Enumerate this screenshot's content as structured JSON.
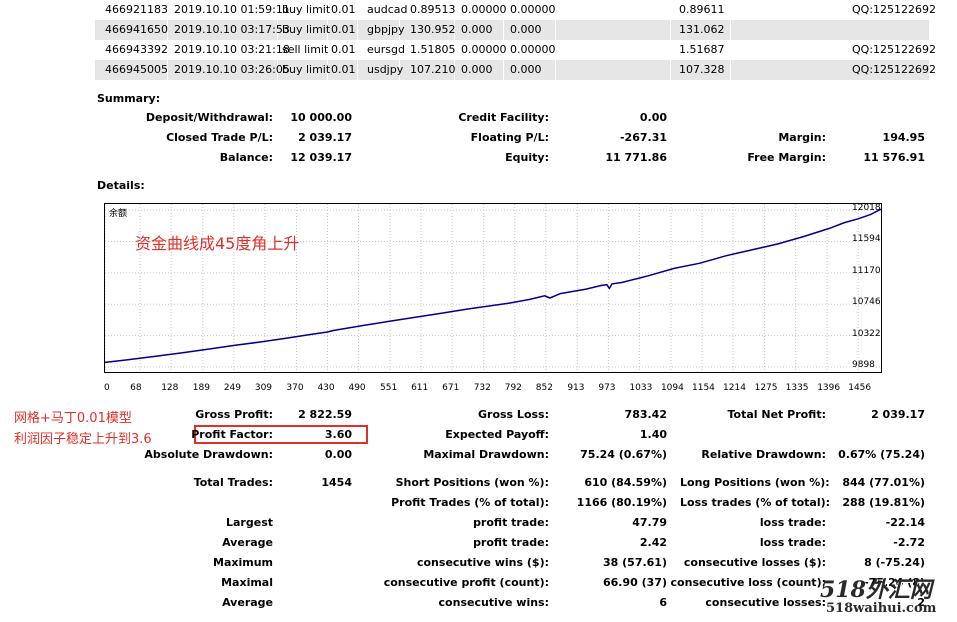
{
  "orders": [
    {
      "ticket": "466921183",
      "time": "2019.10.10 01:59:11",
      "type": "buy limit",
      "size": "0.01",
      "item": "audcad",
      "price": "0.89513",
      "sl": "0.00000",
      "tp": "0.00000",
      "cur_price": "0.89611",
      "comment": "QQ:125122692",
      "shaded": false
    },
    {
      "ticket": "466941650",
      "time": "2019.10.10 03:17:53",
      "type": "buy limit",
      "size": "0.01",
      "item": "gbpjpy",
      "price": "130.952",
      "sl": "0.000",
      "tp": "0.000",
      "cur_price": "131.062",
      "comment": "",
      "shaded": true
    },
    {
      "ticket": "466943392",
      "time": "2019.10.10 03:21:18",
      "type": "sell limit",
      "size": "0.01",
      "item": "eursgd",
      "price": "1.51805",
      "sl": "0.00000",
      "tp": "0.00000",
      "cur_price": "1.51687",
      "comment": "QQ:125122692",
      "shaded": false
    },
    {
      "ticket": "466945005",
      "time": "2019.10.10 03:26:05",
      "type": "buy limit",
      "size": "0.01",
      "item": "usdjpy",
      "price": "107.210",
      "sl": "0.000",
      "tp": "0.000",
      "cur_price": "107.328",
      "comment": "QQ:125122692",
      "shaded": true
    }
  ],
  "summary": {
    "heading": "Summary:",
    "deposit_label": "Deposit/Withdrawal:",
    "deposit_value": "10 000.00",
    "credit_label": "Credit Facility:",
    "credit_value": "0.00",
    "closed_label": "Closed Trade P/L:",
    "closed_value": "2 039.17",
    "floating_label": "Floating P/L:",
    "floating_value": "-267.31",
    "margin_label": "Margin:",
    "margin_value": "194.95",
    "balance_label": "Balance:",
    "balance_value": "12 039.17",
    "equity_label": "Equity:",
    "equity_value": "11 771.86",
    "free_margin_label": "Free Margin:",
    "free_margin_value": "11 576.91"
  },
  "details": {
    "heading": "Details:"
  },
  "annotations": {
    "chart_note": "资金曲线成45度角上升",
    "pf_note_line1": "网格+马丁0.01模型",
    "pf_note_line2": "利润因子稳定上升到3.6",
    "watermark_top": "518外汇网",
    "watermark_bottom": "518waihui.com",
    "red_color": "#e0302a"
  },
  "chart_data": {
    "type": "line",
    "title": "余额",
    "x_ticks": [
      0,
      68,
      128,
      189,
      249,
      309,
      370,
      430,
      490,
      551,
      611,
      671,
      732,
      792,
      852,
      913,
      973,
      1033,
      1094,
      1154,
      1214,
      1275,
      1335,
      1396,
      1456
    ],
    "y_ticks": [
      9898,
      10322,
      10746,
      11170,
      11594,
      12018
    ],
    "xlim": [
      0,
      1500
    ],
    "ylim": [
      9830,
      12100
    ],
    "grid": true,
    "line_color": "#00008b",
    "series": [
      {
        "x": [
          0,
          50,
          100,
          150,
          200,
          250,
          300,
          350,
          400,
          430,
          440,
          500,
          550,
          600,
          650,
          700,
          720,
          780,
          820,
          850,
          860,
          880,
          930,
          960,
          970,
          975,
          980,
          1000,
          1050,
          1100,
          1150,
          1200,
          1250,
          1300,
          1350,
          1400,
          1430,
          1456,
          1480,
          1500
        ],
        "y": [
          9960,
          10000,
          10045,
          10090,
          10140,
          10190,
          10235,
          10285,
          10340,
          10370,
          10390,
          10460,
          10515,
          10570,
          10625,
          10680,
          10700,
          10760,
          10810,
          10860,
          10830,
          10890,
          10950,
          11000,
          11010,
          10960,
          11020,
          11040,
          11130,
          11230,
          11300,
          11400,
          11480,
          11560,
          11660,
          11770,
          11850,
          11900,
          11960,
          12030
        ]
      }
    ]
  },
  "stats": {
    "gross_profit_label": "Gross Profit:",
    "gross_profit_value": "2 822.59",
    "gross_loss_label": "Gross Loss:",
    "gross_loss_value": "783.42",
    "net_profit_label": "Total Net Profit:",
    "net_profit_value": "2 039.17",
    "profit_factor_label": "Profit Factor:",
    "profit_factor_value": "3.60",
    "expected_payoff_label": "Expected Payoff:",
    "expected_payoff_value": "1.40",
    "abs_drawdown_label": "Absolute Drawdown:",
    "abs_drawdown_value": "0.00",
    "max_drawdown_label": "Maximal Drawdown:",
    "max_drawdown_value": "75.24 (0.67%)",
    "rel_drawdown_label": "Relative Drawdown:",
    "rel_drawdown_value": "0.67% (75.24)",
    "total_trades_label": "Total Trades:",
    "total_trades_value": "1454",
    "short_label": "Short Positions (won %):",
    "short_value": "610 (84.59%)",
    "long_label": "Long Positions (won %):",
    "long_value": "844 (77.01%)",
    "profit_trades_label": "Profit Trades (% of total):",
    "profit_trades_value": "1166 (80.19%)",
    "loss_trades_label": "Loss trades (% of total):",
    "loss_trades_value": "288 (19.81%)",
    "largest_label": "Largest",
    "largest_profit_label": "profit trade:",
    "largest_profit_value": "47.79",
    "largest_loss_label": "loss trade:",
    "largest_loss_value": "-22.14",
    "average_label": "Average",
    "average_profit_label": "profit trade:",
    "average_profit_value": "2.42",
    "average_loss_label": "loss trade:",
    "average_loss_value": "-2.72",
    "maximum_label": "Maximum",
    "max_cons_wins_label": "consecutive wins ($):",
    "max_cons_wins_value": "38 (57.61)",
    "max_cons_losses_label": "consecutive losses ($):",
    "max_cons_losses_value": "8 (-75.24)",
    "maximal_label": "Maximal",
    "maximal_profit_label": "consecutive profit (count):",
    "maximal_profit_value": "66.90 (37)",
    "maximal_loss_label": "consecutive loss (count):",
    "maximal_loss_value": "-75.24 (8)",
    "average2_label": "Average",
    "avg_cons_wins_label": "consecutive wins:",
    "avg_cons_wins_value": "6",
    "avg_cons_losses_label": "consecutive losses:",
    "avg_cons_losses_value": "2"
  }
}
